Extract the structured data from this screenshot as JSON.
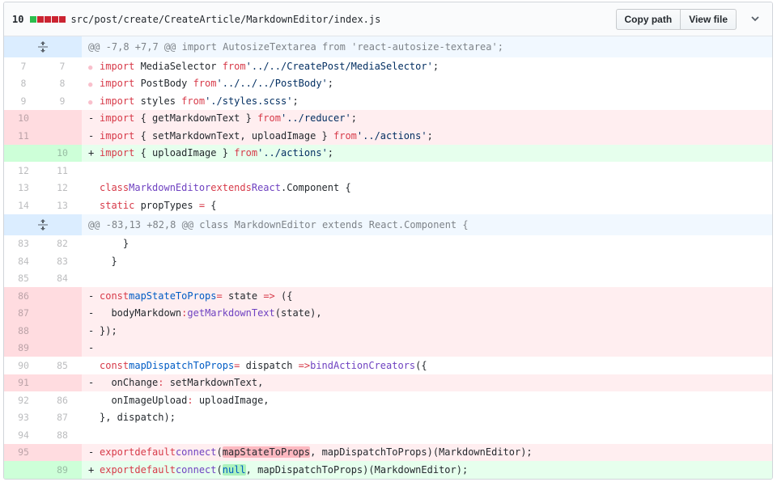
{
  "file": {
    "change_count": "10",
    "path": "src/post/create/CreateArticle/MarkdownEditor/index.js",
    "buttons": {
      "copy_path": "Copy path",
      "view_file": "View file"
    },
    "stat_colors": [
      "#2cbe4e",
      "#cb2431",
      "#cb2431",
      "#cb2431",
      "#cb2431"
    ]
  },
  "hunks": [
    {
      "header": "@@ -7,8 +7,7 @@ import AutosizeTextarea from 'react-autosize-textarea';"
    },
    {
      "header": "@@ -83,13 +82,8 @@ class MarkdownEditor extends React.Component {"
    }
  ],
  "lines": {
    "l7": {
      "old": "7",
      "new": "7",
      "text": "import MediaSelector from '../../CreatePost/MediaSelector';"
    },
    "l8": {
      "old": "8",
      "new": "8",
      "text": "import PostBody from '../../../PostBody';"
    },
    "l9": {
      "old": "9",
      "new": "9",
      "text": "import styles from './styles.scss';"
    },
    "l10d": {
      "old": "10",
      "new": "",
      "text": "import { getMarkdownText } from '../reducer';"
    },
    "l11d": {
      "old": "11",
      "new": "",
      "text": "import { setMarkdownText, uploadImage } from '../actions';"
    },
    "l10a": {
      "old": "",
      "new": "10",
      "text": "import { uploadImage } from '../actions';"
    },
    "l12": {
      "old": "12",
      "new": "11",
      "text": ""
    },
    "l13": {
      "old": "13",
      "new": "12",
      "text": "class MarkdownEditor extends React.Component {"
    },
    "l14": {
      "old": "14",
      "new": "13",
      "text": "  static propTypes = {"
    },
    "l83": {
      "old": "83",
      "new": "82",
      "text": "    }"
    },
    "l84": {
      "old": "84",
      "new": "83",
      "text": "  }"
    },
    "l85": {
      "old": "85",
      "new": "84",
      "text": ""
    },
    "l86": {
      "old": "86",
      "new": "",
      "text": "const mapStateToProps = state => ({"
    },
    "l87": {
      "old": "87",
      "new": "",
      "text": "  bodyMarkdown: getMarkdownText(state),"
    },
    "l88": {
      "old": "88",
      "new": "",
      "text": "});"
    },
    "l89": {
      "old": "89",
      "new": "",
      "text": ""
    },
    "l90": {
      "old": "90",
      "new": "85",
      "text": "const mapDispatchToProps = dispatch => bindActionCreators({"
    },
    "l91": {
      "old": "91",
      "new": "",
      "text": "  onChange: setMarkdownText,"
    },
    "l92": {
      "old": "92",
      "new": "86",
      "text": "  onImageUpload: uploadImage,"
    },
    "l93": {
      "old": "93",
      "new": "87",
      "text": "}, dispatch);"
    },
    "l94": {
      "old": "94",
      "new": "88",
      "text": ""
    },
    "l95": {
      "old": "95",
      "new": "",
      "text": "export default connect(mapStateToProps, mapDispatchToProps)(MarkdownEditor);"
    },
    "l89a": {
      "old": "",
      "new": "89",
      "text": "export default connect(null, mapDispatchToProps)(MarkdownEditor);"
    }
  },
  "markers": {
    "del": "-",
    "add": "+"
  }
}
